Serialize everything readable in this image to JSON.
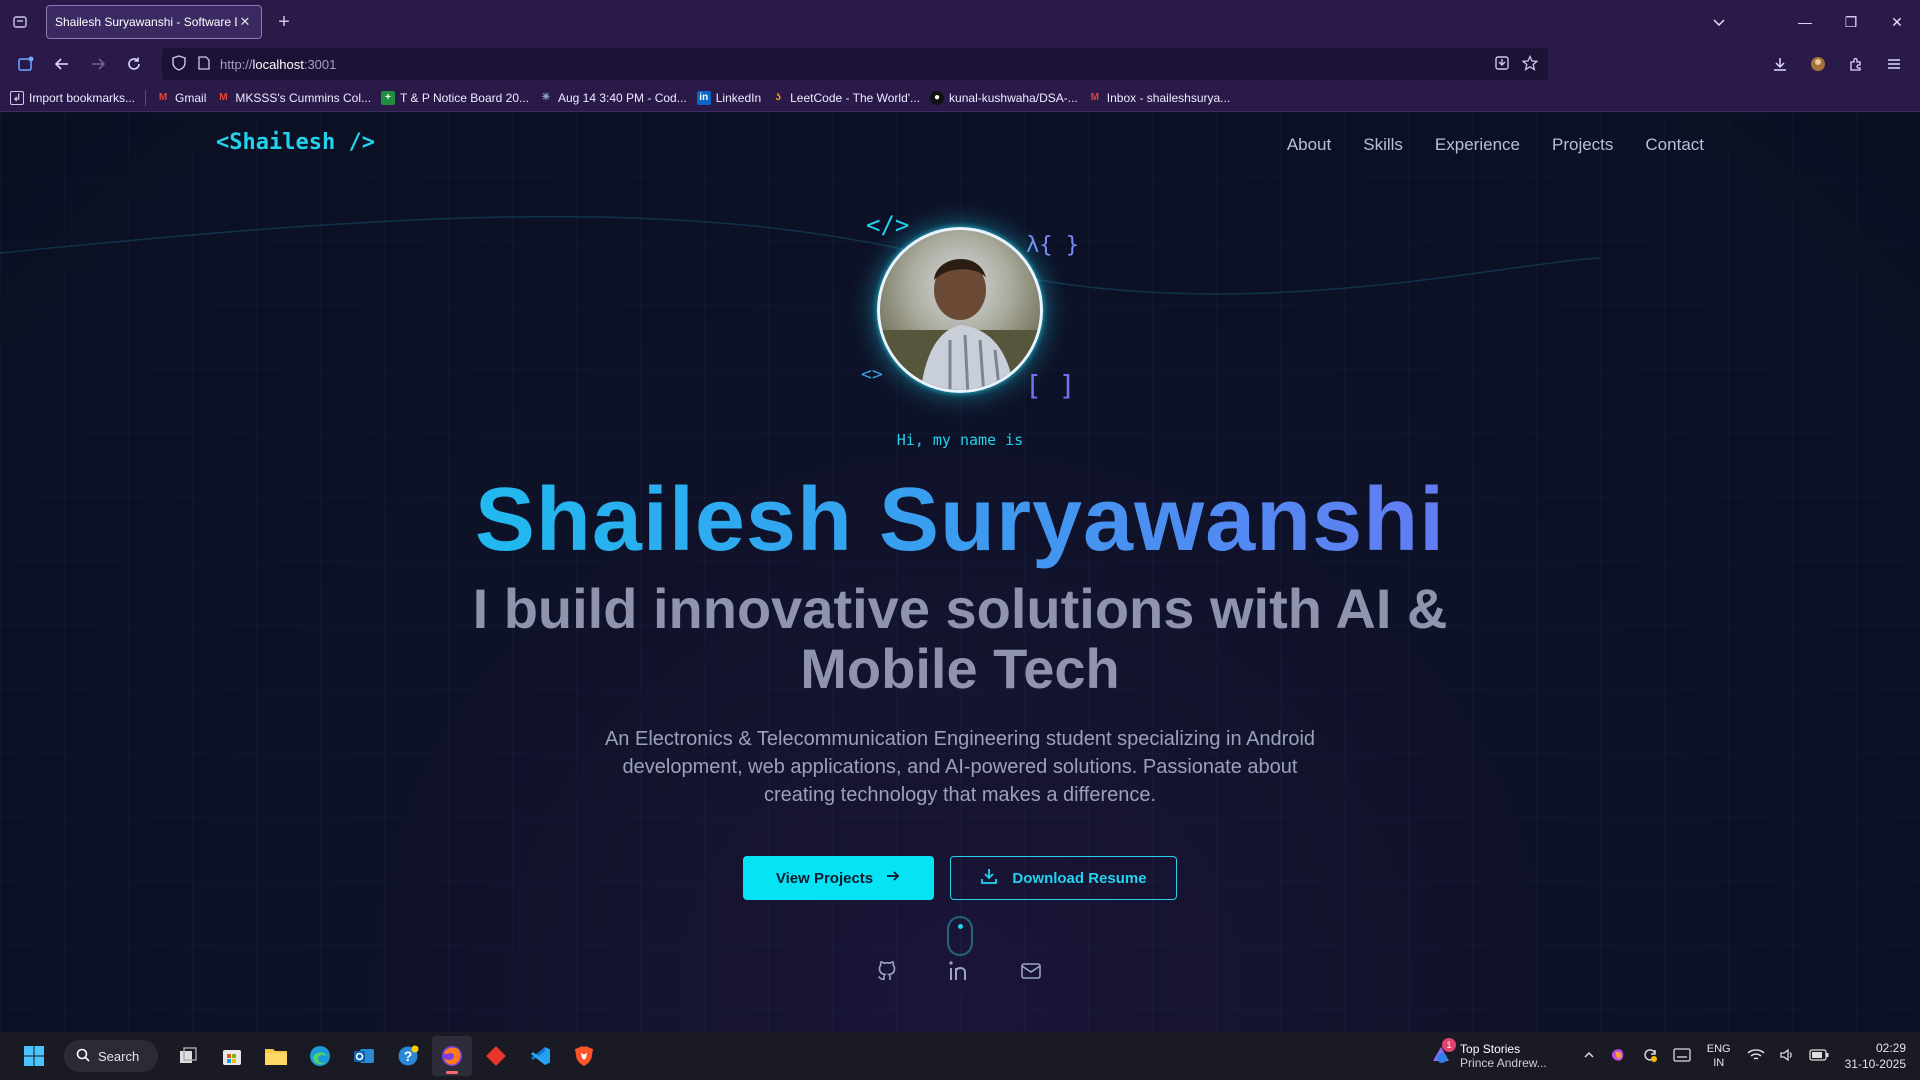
{
  "browser": {
    "tab_title": "Shailesh Suryawanshi - Software De",
    "url_prefix": "http://",
    "url_host": "localhost",
    "url_port": ":3001",
    "bookmarks": [
      {
        "label": "Import bookmarks...",
        "icon": "import-icon"
      },
      {
        "label": "Gmail",
        "icon": "gmail-icon"
      },
      {
        "label": "MKSSS's Cummins Col...",
        "icon": "gmail-icon"
      },
      {
        "label": "T & P Notice Board 20...",
        "icon": "sheets-icon"
      },
      {
        "label": "Aug 14 3:40 PM - Cod...",
        "icon": "code-icon"
      },
      {
        "label": "LinkedIn",
        "icon": "linkedin-icon"
      },
      {
        "label": "LeetCode - The World'...",
        "icon": "leetcode-icon"
      },
      {
        "label": "kunal-kushwaha/DSA-...",
        "icon": "github-icon"
      },
      {
        "label": "Inbox - shaileshsurya...",
        "icon": "gmail-icon"
      }
    ]
  },
  "site": {
    "logo": "<Shailesh />",
    "nav": [
      "About",
      "Skills",
      "Experience",
      "Projects",
      "Contact"
    ],
    "deco": {
      "tag": "</>",
      "lambda": "λ{ }",
      "angle": "<>",
      "brackets": "[ ]"
    },
    "greeting": "Hi, my name is",
    "name": "Shailesh Suryawanshi",
    "tagline": "I build innovative solutions with AI & Mobile Tech",
    "description": "An Electronics & Telecommunication Engineering student specializing in Android development, web applications, and AI-powered solutions. Passionate about creating technology that makes a difference.",
    "primary_button": "View Projects",
    "secondary_button": "Download Resume",
    "accent": "#22d3ee"
  },
  "taskbar": {
    "search_label": "Search",
    "news_title": "Top Stories",
    "news_sub": "Prince Andrew...",
    "news_badge": "1",
    "lang_top": "ENG",
    "lang_bottom": "IN",
    "time": "02:29",
    "date": "31-10-2025"
  }
}
